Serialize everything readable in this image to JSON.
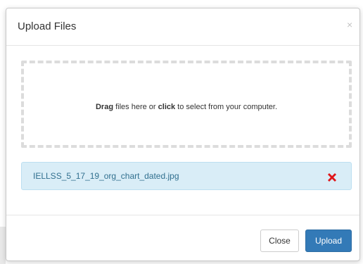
{
  "modal": {
    "title": "Upload Files",
    "close_glyph": "×"
  },
  "dropzone": {
    "text_drag": "Drag",
    "text_mid": " files here or ",
    "text_click": "click",
    "text_end": " to select from your computer."
  },
  "file": {
    "name": "IELLSS_5_17_19_org_chart_dated.jpg",
    "remove_icon": "red-x-icon"
  },
  "footer": {
    "close_label": "Close",
    "upload_label": "Upload"
  },
  "colors": {
    "primary": "#337ab7",
    "file_row_bg": "#d9edf7",
    "file_name_text": "#31708f",
    "remove_red": "#e0161a"
  }
}
